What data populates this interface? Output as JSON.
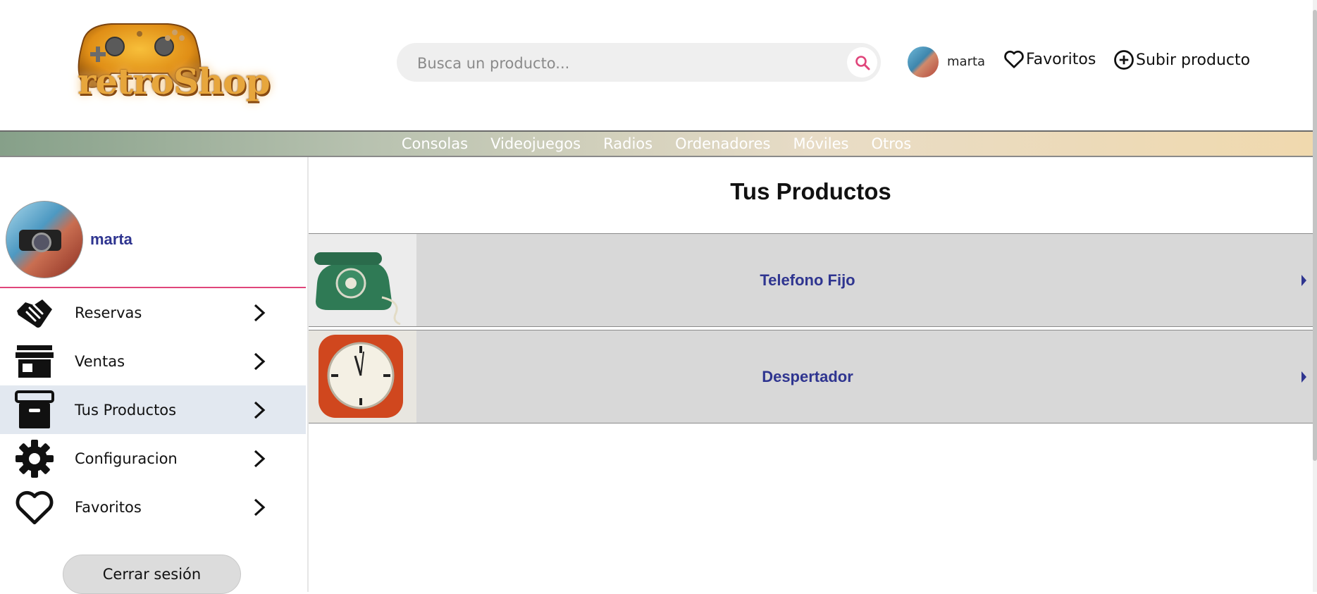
{
  "header": {
    "logo_text": "retroShop",
    "search_placeholder": "Busca un producto...",
    "user_name": "marta",
    "favorites_label": "Favoritos",
    "upload_label": "Subir producto"
  },
  "categories": [
    "Consolas",
    "Videojuegos",
    "Radios",
    "Ordenadores",
    "Móviles",
    "Otros"
  ],
  "sidebar": {
    "user_name": "marta",
    "items": [
      {
        "label": "Reservas",
        "icon": "handshake-icon"
      },
      {
        "label": "Ventas",
        "icon": "store-icon"
      },
      {
        "label": "Tus Productos",
        "icon": "archive-box-icon",
        "active": true
      },
      {
        "label": "Configuracion",
        "icon": "gear-icon"
      },
      {
        "label": "Favoritos",
        "icon": "heart-icon"
      }
    ],
    "logout_label": "Cerrar sesión"
  },
  "main": {
    "title": "Tus Productos",
    "products": [
      {
        "name": "Telefono Fijo",
        "image": "green-rotary-phone"
      },
      {
        "name": "Despertador",
        "image": "orange-alarm-clock"
      }
    ]
  },
  "colors": {
    "accent_pink": "#e0457b",
    "link_blue": "#2f3590",
    "row_gray": "#d8d8d8",
    "active_bg": "#e2e8f0"
  }
}
